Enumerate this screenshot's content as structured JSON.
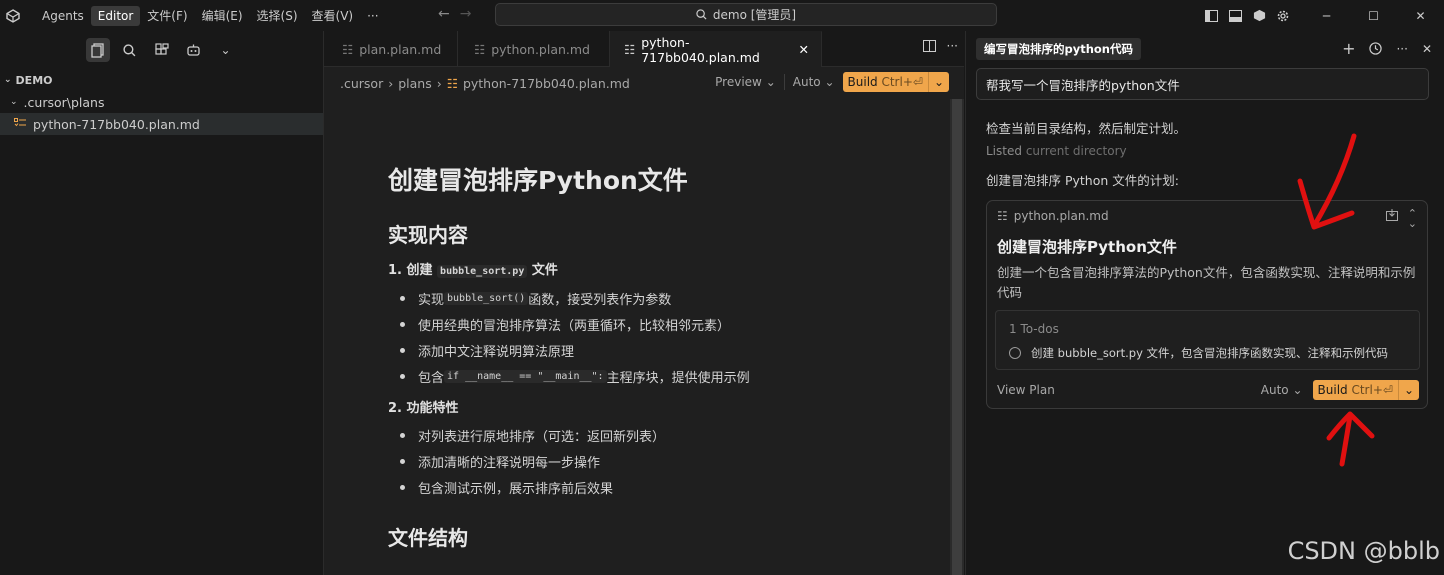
{
  "titlebar": {
    "menu": [
      "Agents",
      "Editor",
      "文件(F)",
      "编辑(E)",
      "选择(S)",
      "查看(V)",
      "···"
    ],
    "search": "demo [管理员]"
  },
  "sidebar": {
    "root": "DEMO",
    "folder": ".cursor\\plans",
    "file": "python-717bb040.plan.md"
  },
  "editor": {
    "tabs": [
      "plan.plan.md",
      "python.plan.md",
      "python-717bb040.plan.md"
    ],
    "breadcrumb": [
      ".cursor",
      "plans",
      "python-717bb040.plan.md"
    ],
    "preview": "Preview",
    "auto": "Auto",
    "build_label": "Build",
    "build_shortcut": "Ctrl+⏎",
    "doc": {
      "h1": "创建冒泡排序Python文件",
      "h2a": "实现内容",
      "item1_pre": "1. 创建 ",
      "item1_code": "bubble_sort.py",
      "item1_post": " 文件",
      "b1_pre": "实现 ",
      "b1_code": "bubble_sort()",
      "b1_post": " 函数，接受列表作为参数",
      "b2": "使用经典的冒泡排序算法（两重循环，比较相邻元素）",
      "b3": "添加中文注释说明算法原理",
      "b4_pre": "包含 ",
      "b4_code": "if __name__ == \"__main__\":",
      "b4_post": " 主程序块，提供使用示例",
      "item2": "2. 功能特性",
      "c1": "对列表进行原地排序（可选：返回新列表）",
      "c2": "添加清晰的注释说明每一步操作",
      "c3": "包含测试示例，展示排序前后效果",
      "h2b": "文件结构"
    }
  },
  "chat": {
    "title": "编写冒泡排序的python代码",
    "user_msg": "帮我写一个冒泡排序的python文件",
    "msg1": "检查当前目录结构，然后制定计划。",
    "msg2a": "Listed",
    "msg2b": "current directory",
    "msg3": "创建冒泡排序 Python 文件的计划:",
    "card": {
      "file": "python.plan.md",
      "title": "创建冒泡排序Python文件",
      "desc": "创建一个包含冒泡排序算法的Python文件，包含函数实现、注释说明和示例代码",
      "todos_header": "1 To-dos",
      "todo_item": "创建 bubble_sort.py 文件，包含冒泡排序函数实现、注释和示例代码",
      "view_plan": "View Plan",
      "auto": "Auto",
      "build_label": "Build",
      "build_shortcut": "Ctrl+⏎"
    }
  },
  "watermark": "CSDN @bblb",
  "colors": {
    "accent": "#f0a64b",
    "annotation": "#e01010"
  }
}
